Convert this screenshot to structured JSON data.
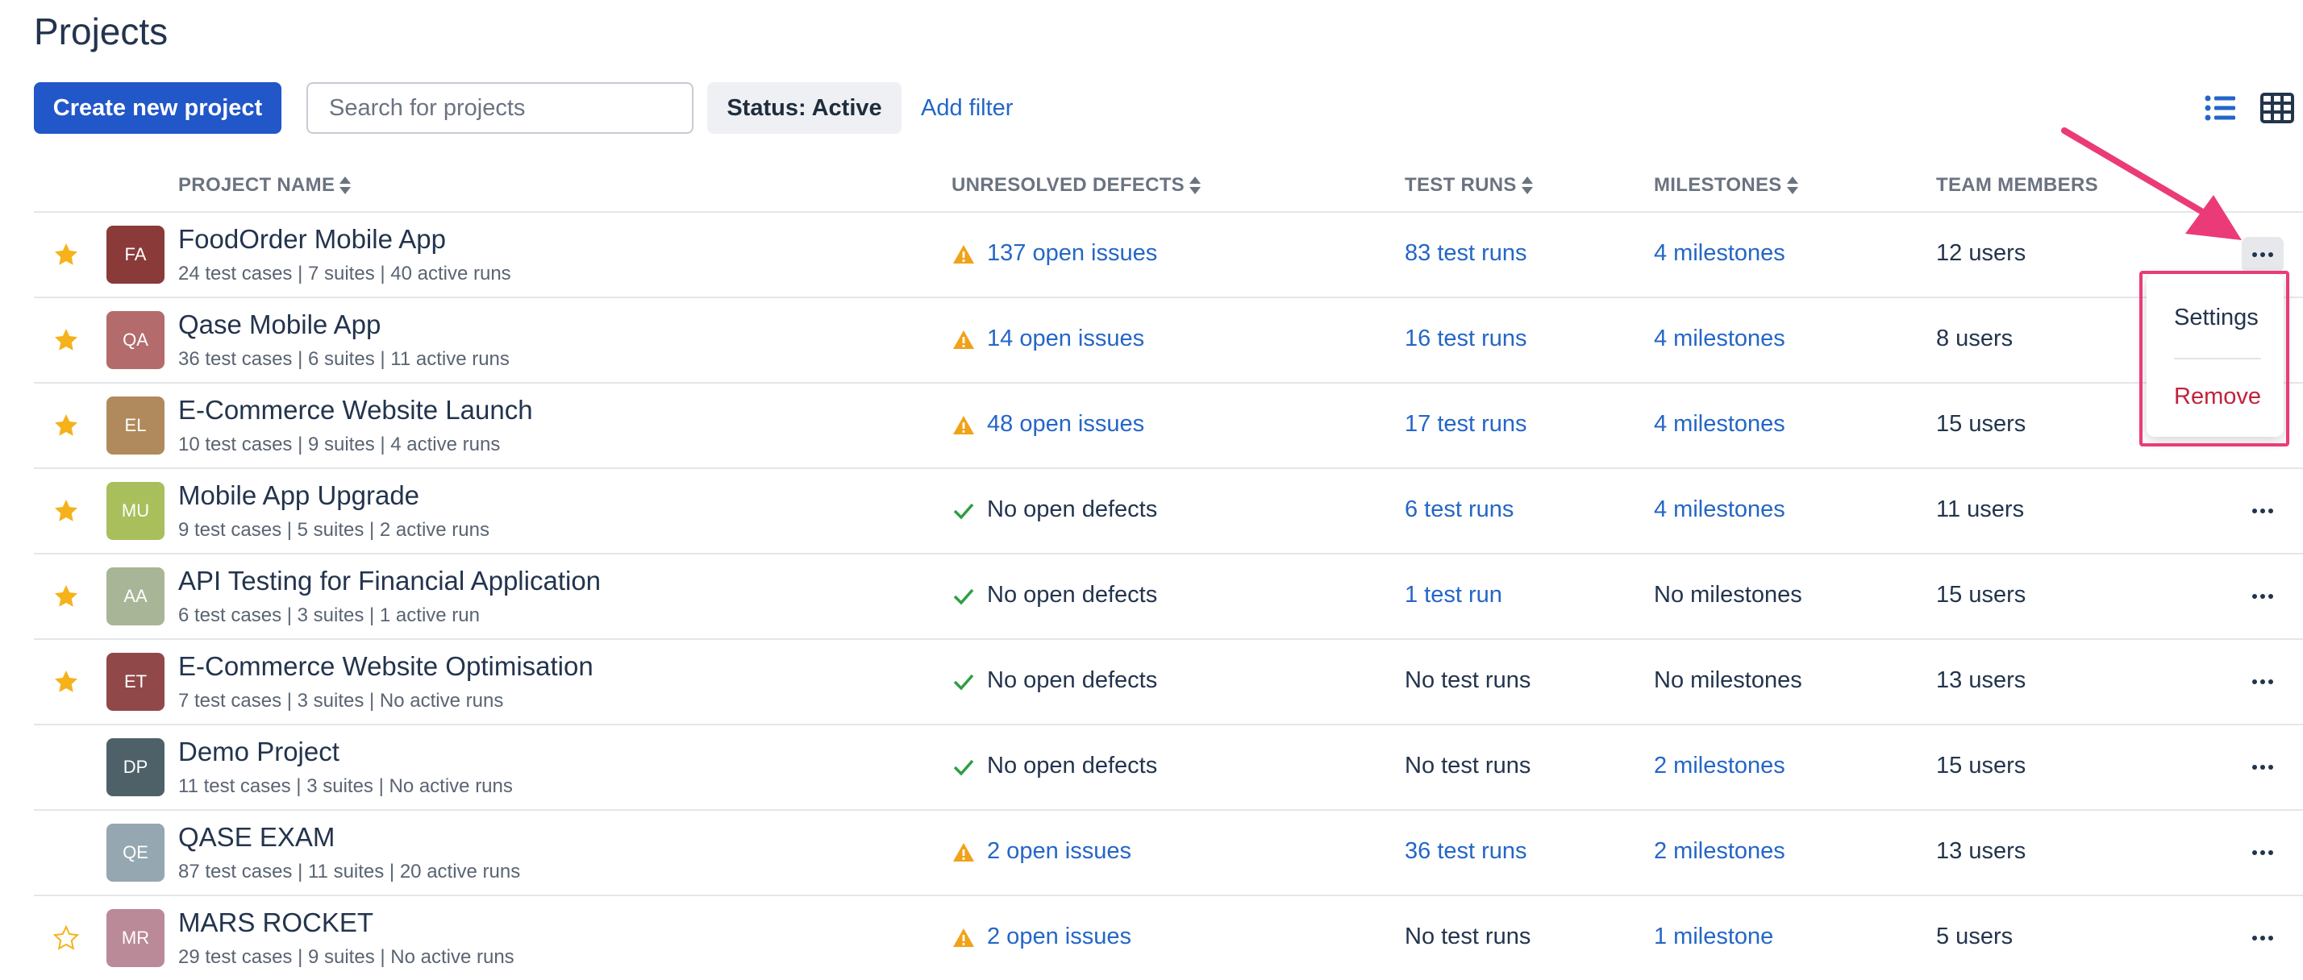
{
  "page": {
    "title": "Projects"
  },
  "toolbar": {
    "create_label": "Create new project",
    "search_placeholder": "Search for projects",
    "status_label": "Status: Active",
    "add_filter_label": "Add filter",
    "list_view_icon": "list-view-icon",
    "grid_view_icon": "grid-view-icon"
  },
  "colors": {
    "primary": "#2257c9",
    "link": "#2466c7",
    "warning": "#f0a21a",
    "success": "#2f9e44",
    "star": "#f5b21b",
    "danger": "#c0223b",
    "highlight": "#ea3b78"
  },
  "table": {
    "headers": {
      "project_name": "PROJECT NAME",
      "unresolved_defects": "UNRESOLVED DEFECTS",
      "test_runs": "TEST RUNS",
      "milestones": "MILESTONES",
      "team_members": "TEAM MEMBERS"
    },
    "rows": [
      {
        "starred": true,
        "initials": "FA",
        "avatar_color": "#8b3a3a",
        "name": "FoodOrder Mobile App",
        "sub": "24 test cases | 7 suites | 40 active runs",
        "defects": "137 open issues",
        "has_defects": true,
        "runs": "83 test runs",
        "runs_link": true,
        "milestones": "4 milestones",
        "milestones_link": true,
        "users": "12 users"
      },
      {
        "starred": true,
        "initials": "QA",
        "avatar_color": "#b36b6b",
        "name": "Qase Mobile App",
        "sub": "36 test cases | 6 suites | 11 active runs",
        "defects": "14 open issues",
        "has_defects": true,
        "runs": "16 test runs",
        "runs_link": true,
        "milestones": "4 milestones",
        "milestones_link": true,
        "users": "8 users"
      },
      {
        "starred": true,
        "initials": "EL",
        "avatar_color": "#b08a5c",
        "name": "E-Commerce Website Launch",
        "sub": "10 test cases | 9 suites | 4 active runs",
        "defects": "48 open issues",
        "has_defects": true,
        "runs": "17 test runs",
        "runs_link": true,
        "milestones": "4 milestones",
        "milestones_link": true,
        "users": "15 users"
      },
      {
        "starred": true,
        "initials": "MU",
        "avatar_color": "#a9bf5c",
        "name": "Mobile App Upgrade",
        "sub": "9 test cases | 5 suites | 2 active runs",
        "defects": "No open defects",
        "has_defects": false,
        "runs": "6 test runs",
        "runs_link": true,
        "milestones": "4 milestones",
        "milestones_link": true,
        "users": "11 users"
      },
      {
        "starred": true,
        "initials": "AA",
        "avatar_color": "#a8b596",
        "name": "API Testing for Financial Application",
        "sub": "6 test cases | 3 suites | 1 active run",
        "defects": "No open defects",
        "has_defects": false,
        "runs": "1 test run",
        "runs_link": true,
        "milestones": "No milestones",
        "milestones_link": false,
        "users": "15 users"
      },
      {
        "starred": true,
        "initials": "ET",
        "avatar_color": "#914848",
        "name": "E-Commerce Website Optimisation",
        "sub": "7 test cases | 3 suites | No active runs",
        "defects": "No open defects",
        "has_defects": false,
        "runs": "No test runs",
        "runs_link": false,
        "milestones": "No milestones",
        "milestones_link": false,
        "users": "13 users"
      },
      {
        "starred": false,
        "initials": "DP",
        "avatar_color": "#4e6168",
        "name": "Demo Project",
        "sub": "11 test cases | 3 suites | No active runs",
        "defects": "No open defects",
        "has_defects": false,
        "runs": "No test runs",
        "runs_link": false,
        "milestones": "2 milestones",
        "milestones_link": true,
        "users": "15 users"
      },
      {
        "starred": false,
        "initials": "QE",
        "avatar_color": "#95a7b0",
        "name": "QASE EXAM",
        "sub": "87 test cases | 11 suites | 20 active runs",
        "defects": "2 open issues",
        "has_defects": true,
        "runs": "36 test runs",
        "runs_link": true,
        "milestones": "2 milestones",
        "milestones_link": true,
        "users": "13 users"
      },
      {
        "starred": false,
        "star_outline": true,
        "initials": "MR",
        "avatar_color": "#bb8a98",
        "name": "MARS ROCKET",
        "sub": "29 test cases | 9 suites | No active runs",
        "defects": "2 open issues",
        "has_defects": true,
        "runs": "No test runs",
        "runs_link": false,
        "milestones": "1 milestone",
        "milestones_link": true,
        "users": "5 users"
      }
    ]
  },
  "context_menu": {
    "settings_label": "Settings",
    "remove_label": "Remove"
  }
}
